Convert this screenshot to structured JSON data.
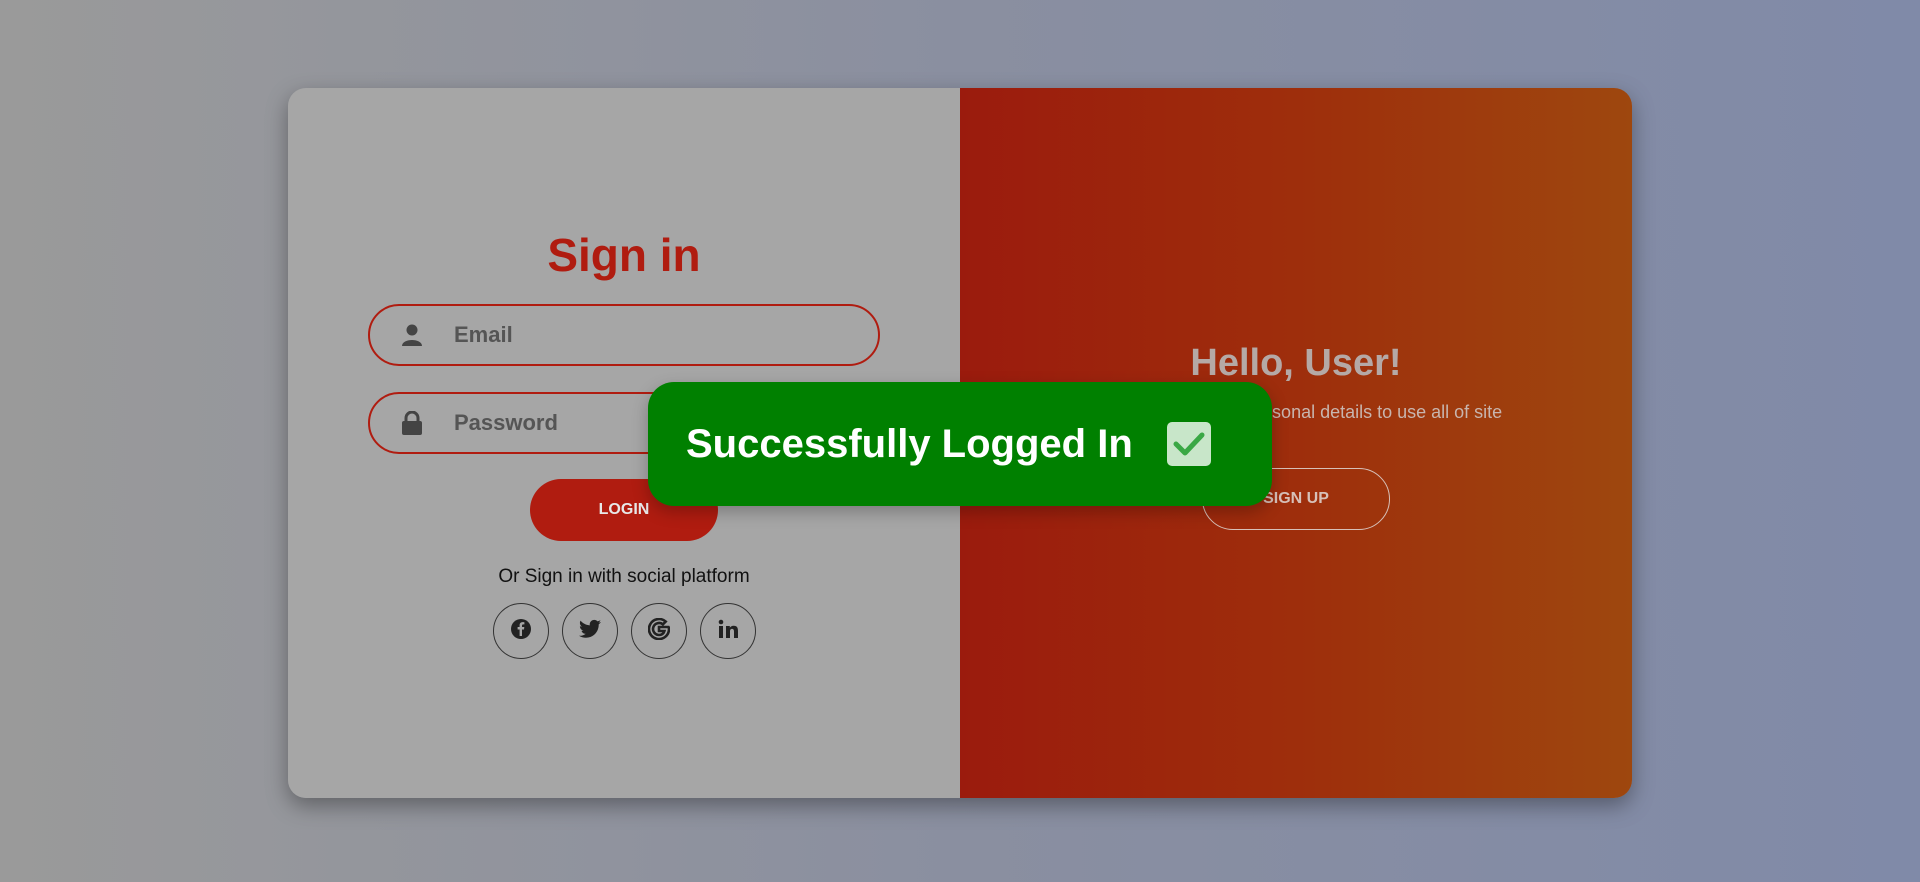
{
  "signin": {
    "title": "Sign in",
    "email_placeholder": "Email",
    "password_placeholder": "Password",
    "login_label": "LOGIN",
    "social_text": "Or Sign in with social platform",
    "socials": [
      "facebook-icon",
      "twitter-icon",
      "google-icon",
      "linkedin-icon"
    ]
  },
  "panel": {
    "heading": "Hello, User!",
    "subtext": "Enter your personal details to use all of site features",
    "signup_label": "SIGN UP"
  },
  "toast": {
    "message": "Successfully Logged In",
    "icon": "checkmark-icon"
  },
  "colors": {
    "accent": "#b01c10",
    "toast_bg": "#008000",
    "panel_start": "#9b1b0d",
    "panel_end": "#9e470e"
  }
}
